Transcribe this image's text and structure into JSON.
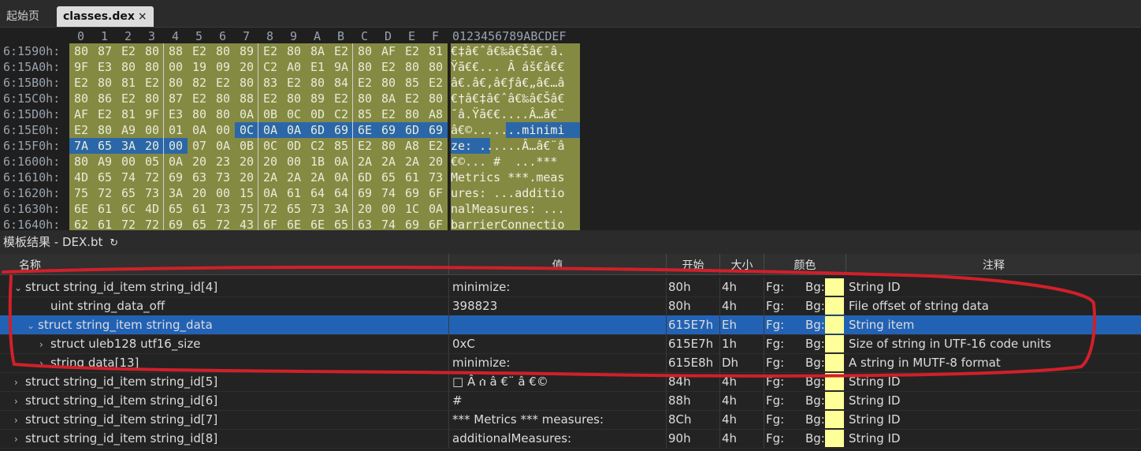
{
  "tabs": [
    {
      "label": "起始页"
    },
    {
      "label": "classes.dex",
      "close": "×"
    }
  ],
  "hex_header": {
    "columns": [
      "0",
      "1",
      "2",
      "3",
      "4",
      "5",
      "6",
      "7",
      "8",
      "9",
      "A",
      "B",
      "C",
      "D",
      "E",
      "F"
    ],
    "ascii_header": "0123456789ABCDEF"
  },
  "hex_rows": [
    {
      "addr": "6:1590h:",
      "bytes": [
        "80",
        "87",
        "E2",
        "80",
        "88",
        "E2",
        "80",
        "89",
        "E2",
        "80",
        "8A",
        "E2",
        "80",
        "AF",
        "E2",
        "81"
      ],
      "ascii": "€‡â€ˆâ€‰â€Šâ€¯â."
    },
    {
      "addr": "6:15A0h:",
      "bytes": [
        "9F",
        "E3",
        "80",
        "80",
        "00",
        "19",
        "09",
        "20",
        "C2",
        "A0",
        "E1",
        "9A",
        "80",
        "E2",
        "80",
        "80"
      ],
      "ascii": "Ÿã€€... Â áš€â€€"
    },
    {
      "addr": "6:15B0h:",
      "bytes": [
        "E2",
        "80",
        "81",
        "E2",
        "80",
        "82",
        "E2",
        "80",
        "83",
        "E2",
        "80",
        "84",
        "E2",
        "80",
        "85",
        "E2"
      ],
      "ascii": "â€.â€‚â€ƒâ€„â€…â"
    },
    {
      "addr": "6:15C0h:",
      "bytes": [
        "80",
        "86",
        "E2",
        "80",
        "87",
        "E2",
        "80",
        "88",
        "E2",
        "80",
        "89",
        "E2",
        "80",
        "8A",
        "E2",
        "80"
      ],
      "ascii": "€†â€‡â€ˆâ€‰â€Šâ€"
    },
    {
      "addr": "6:15D0h:",
      "bytes": [
        "AF",
        "E2",
        "81",
        "9F",
        "E3",
        "80",
        "80",
        "0A",
        "0B",
        "0C",
        "0D",
        "C2",
        "85",
        "E2",
        "80",
        "A8"
      ],
      "ascii": "¯â.Ÿã€€....Â…â€¨"
    },
    {
      "addr": "6:15E0h:",
      "bytes": [
        "E2",
        "80",
        "A9",
        "00",
        "01",
        "0A",
        "00",
        "0C",
        "0A",
        "0A",
        "6D",
        "69",
        "6E",
        "69",
        "6D",
        "69"
      ],
      "ascii": "â€©.......minimi"
    },
    {
      "addr": "6:15F0h:",
      "bytes": [
        "7A",
        "65",
        "3A",
        "20",
        "00",
        "07",
        "0A",
        "0B",
        "0C",
        "0D",
        "C2",
        "85",
        "E2",
        "80",
        "A8",
        "E2"
      ],
      "ascii": "ze: ......Â…â€¨â"
    },
    {
      "addr": "6:1600h:",
      "bytes": [
        "80",
        "A9",
        "00",
        "05",
        "0A",
        "20",
        "23",
        "20",
        "20",
        "00",
        "1B",
        "0A",
        "2A",
        "2A",
        "2A",
        "20"
      ],
      "ascii": "€©... #  ...*** "
    },
    {
      "addr": "6:1610h:",
      "bytes": [
        "4D",
        "65",
        "74",
        "72",
        "69",
        "63",
        "73",
        "20",
        "2A",
        "2A",
        "2A",
        "0A",
        "6D",
        "65",
        "61",
        "73"
      ],
      "ascii": "Metrics ***.meas"
    },
    {
      "addr": "6:1620h:",
      "bytes": [
        "75",
        "72",
        "65",
        "73",
        "3A",
        "20",
        "00",
        "15",
        "0A",
        "61",
        "64",
        "64",
        "69",
        "74",
        "69",
        "6F"
      ],
      "ascii": "ures: ...additio"
    },
    {
      "addr": "6:1630h:",
      "bytes": [
        "6E",
        "61",
        "6C",
        "4D",
        "65",
        "61",
        "73",
        "75",
        "72",
        "65",
        "73",
        "3A",
        "20",
        "00",
        "1C",
        "0A"
      ],
      "ascii": "nalMeasures: ..."
    },
    {
      "addr": "6:1640h:",
      "bytes": [
        "62",
        "61",
        "72",
        "72",
        "69",
        "65",
        "72",
        "43",
        "6F",
        "6E",
        "6E",
        "65",
        "63",
        "74",
        "69",
        "6F"
      ],
      "ascii": "barrierConnectio"
    }
  ],
  "template_panel": {
    "title": "模板结果 - DEX.bt",
    "refresh_icon": "↻"
  },
  "table": {
    "headers": {
      "name": "名称",
      "value": "值",
      "start": "开始",
      "size": "大小",
      "color": "颜色",
      "comment": "注释"
    },
    "rows": [
      {
        "arrow": "⌄",
        "name": "struct string_id_item string_id[4]",
        "value": " minimize:",
        "start": "80h",
        "size": "4h",
        "fg": "Fg:",
        "bg": "Bg:",
        "comment": "String ID"
      },
      {
        "arrow": "",
        "name": "uint string_data_off",
        "value": "398823",
        "start": "80h",
        "size": "4h",
        "fg": "Fg:",
        "bg": "Bg:",
        "comment": "File offset of string data"
      },
      {
        "arrow": "⌄",
        "name": "struct string_item string_data",
        "value": "",
        "start": "615E7h",
        "size": "Eh",
        "fg": "Fg:",
        "bg": "Bg:",
        "comment": "String item"
      },
      {
        "arrow": "›",
        "name": "struct uleb128 utf16_size",
        "value": "0xC",
        "start": "615E7h",
        "size": "1h",
        "fg": "Fg:",
        "bg": "Bg:",
        "comment": "Size of string in UTF-16 code units"
      },
      {
        "arrow": "›",
        "name": "string data[13]",
        "value": " minimize:",
        "start": "615E8h",
        "size": "Dh",
        "fg": "Fg:",
        "bg": "Bg:",
        "comment": "A string in MUTF-8 format"
      },
      {
        "arrow": "›",
        "name": "struct string_id_item string_id[5]",
        "value": "□ Â ሰ â €¨ â €©",
        "start": "84h",
        "size": "4h",
        "fg": "Fg:",
        "bg": "Bg:",
        "comment": "String ID"
      },
      {
        "arrow": "›",
        "name": "struct string_id_item string_id[6]",
        "value": " #",
        "start": "88h",
        "size": "4h",
        "fg": "Fg:",
        "bg": "Bg:",
        "comment": "String ID"
      },
      {
        "arrow": "›",
        "name": "struct string_id_item string_id[7]",
        "value": " *** Metrics *** measures:",
        "start": "8Ch",
        "size": "4h",
        "fg": "Fg:",
        "bg": "Bg:",
        "comment": "String ID"
      },
      {
        "arrow": "›",
        "name": "struct string_id_item string_id[8]",
        "value": " additionalMeasures:",
        "start": "90h",
        "size": "4h",
        "fg": "Fg:",
        "bg": "Bg:",
        "comment": "String ID"
      }
    ]
  },
  "colors": {
    "swatch_bg": "#ffff99",
    "selection": "#2262b5",
    "hex_highlight": "#858a43",
    "annotation": "#d0202a"
  }
}
